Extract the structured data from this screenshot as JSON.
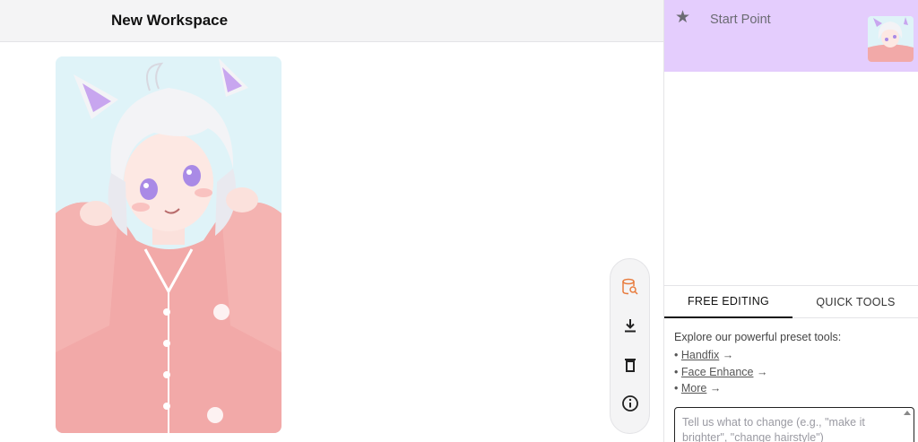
{
  "workspace": {
    "title": "New Workspace"
  },
  "toolbar": {
    "buttons": [
      {
        "icon": "search-document-icon",
        "color": "#e87c3e"
      },
      {
        "icon": "download-icon",
        "color": "#222222"
      },
      {
        "icon": "trash-icon",
        "color": "#222222"
      },
      {
        "icon": "info-icon",
        "color": "#222222"
      }
    ]
  },
  "history": {
    "items": [
      {
        "label": "Start Point",
        "icon": "star-icon",
        "selected": true
      }
    ]
  },
  "tabs": [
    {
      "label": "FREE EDITING",
      "active": true
    },
    {
      "label": "QUICK TOOLS",
      "active": false
    }
  ],
  "tools": {
    "intro": "Explore our powerful preset tools:",
    "links": [
      {
        "label": "Handfix",
        "arrow": "→"
      },
      {
        "label": "Face Enhance",
        "arrow": "→"
      },
      {
        "label": "More",
        "arrow": "→"
      }
    ]
  },
  "prompt": {
    "placeholder": "Tell us what to change (e.g., \"make it brighter\", \"change hairstyle\")"
  },
  "colors": {
    "selected_bg": "#e4cdfd",
    "header_bg": "#f4f4f5",
    "accent_icon": "#e87c3e"
  }
}
